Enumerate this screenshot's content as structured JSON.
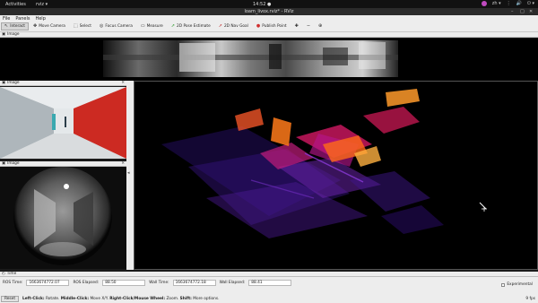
{
  "topbar": {
    "activities": "Activities",
    "app_name": "rviz ▾",
    "clock": "14:52 ●",
    "tray": [
      "zh ▾",
      "⋮",
      "🔊",
      "⏻ ▾"
    ]
  },
  "window": {
    "title": "loam_livox.rviz* - RViz"
  },
  "menu": {
    "file": "File",
    "panels": "Panels",
    "help": "Help"
  },
  "toolbar": {
    "interact": "Interact",
    "move_camera": "Move Camera",
    "select": "Select",
    "focus_camera": "Focus Camera",
    "measure": "Measure",
    "pose_estimate": "2D Pose Estimate",
    "nav_goal": "2D Nav Goal",
    "publish_point": "Publish Point",
    "extra_icons": [
      "✚",
      "−",
      "⊕"
    ]
  },
  "panels": {
    "top_image": "Image",
    "left_image_1": "Image",
    "left_image_2": "Image"
  },
  "time": {
    "panel_title": "Time",
    "ros_time_label": "ROS Time:",
    "ros_time_value": "1663674772.07",
    "ros_elapsed_label": "ROS Elapsed:",
    "ros_elapsed_value": "88.50",
    "wall_time_label": "Wall Time:",
    "wall_time_value": "1663674772.18",
    "wall_elapsed_label": "Wall Elapsed:",
    "wall_elapsed_value": "88.41",
    "experimental_label": "Experimental"
  },
  "status": {
    "reset_label": "Reset",
    "hint_k1": "Left-Click:",
    "hint_v1": " Rotate. ",
    "hint_k2": "Middle-Click:",
    "hint_v2": " Move X/Y. ",
    "hint_k3": "Right-Click/Mouse Wheel:",
    "hint_v3": " Zoom. ",
    "hint_k4": "Shift:",
    "hint_v4": " More options.",
    "fps": "9 fps"
  },
  "colors": {
    "pointcloud_hot": "#ff7a1a",
    "pointcloud_mid": "#e01a6a",
    "pointcloud_cool": "#5a1fb0",
    "pointcloud_dark": "#2a1070"
  }
}
